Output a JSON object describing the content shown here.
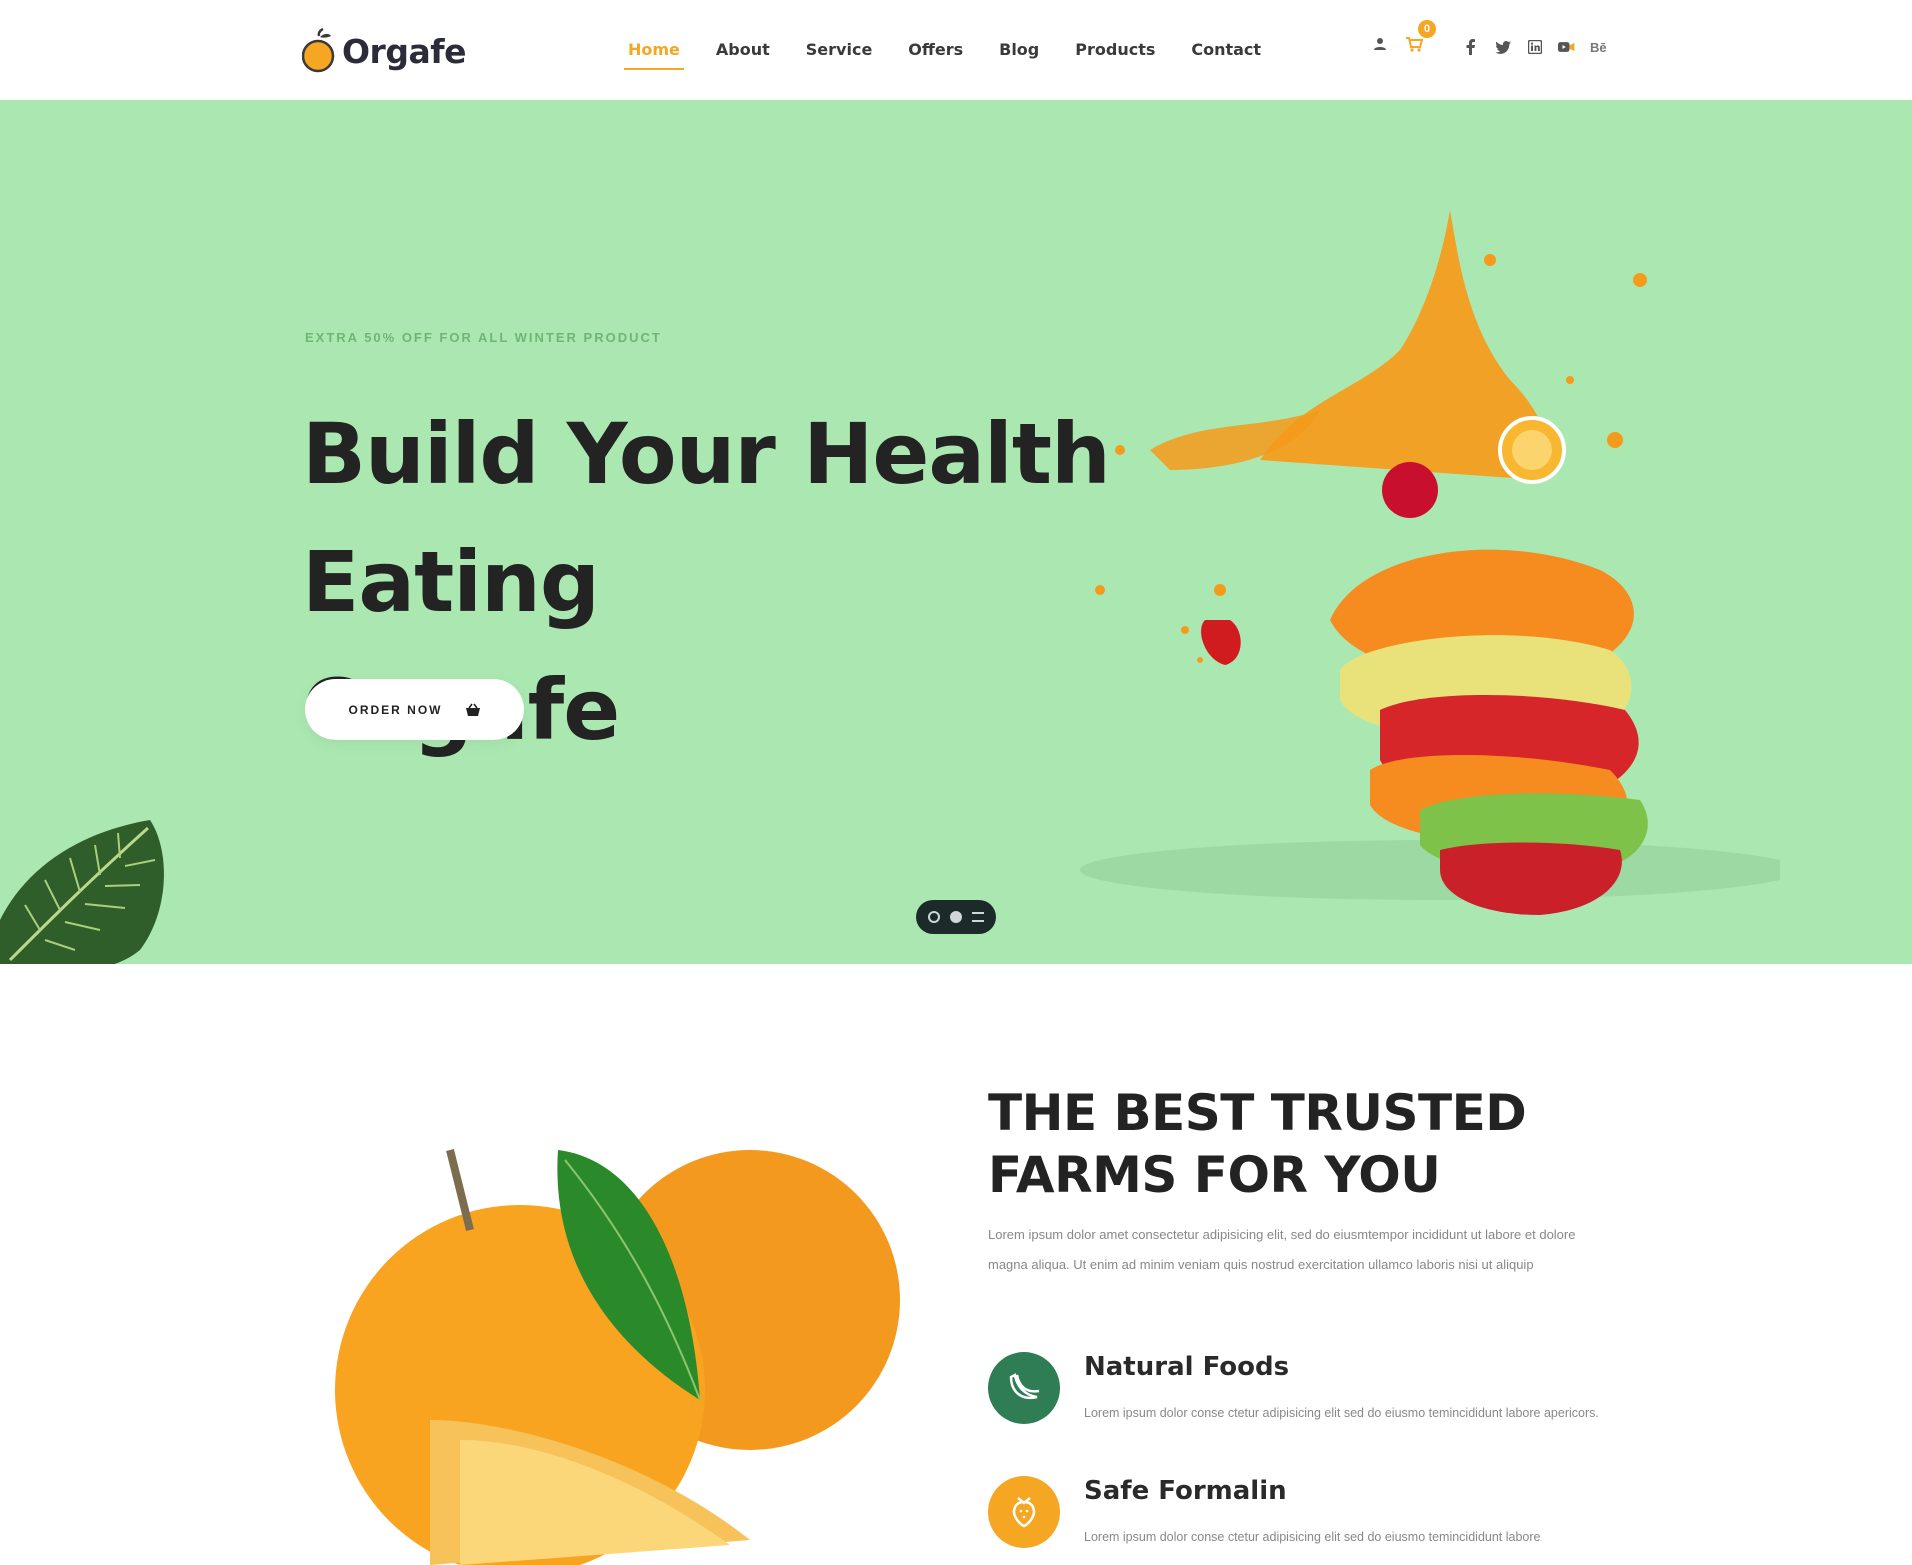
{
  "brand": {
    "name": "Orgafe",
    "accent": "#f5a623",
    "green": "#2e7d55",
    "hero_bg": "#abe8b1"
  },
  "nav": {
    "items": [
      {
        "label": "Home",
        "active": true
      },
      {
        "label": "About"
      },
      {
        "label": "Service"
      },
      {
        "label": "Offers"
      },
      {
        "label": "Blog"
      },
      {
        "label": "Products"
      },
      {
        "label": "Contact"
      }
    ]
  },
  "header": {
    "cart_count": "0",
    "icons": [
      "user-icon",
      "cart-icon"
    ],
    "social": [
      "facebook-icon",
      "twitter-icon",
      "linkedin-icon",
      "youtube-icon",
      "behance-icon"
    ],
    "behance_label": "Bē"
  },
  "hero": {
    "tag": "EXTRA 50% OFF FOR ALL WINTER PRODUCT",
    "title_line1": "Build Your Health Eating",
    "title_line2": "Orgafe",
    "button_label": "ORDER NOW"
  },
  "about": {
    "title_line1": "THE BEST TRUSTED",
    "title_line2": "FARMS FOR YOU",
    "description": "Lorem ipsum dolor amet consectetur adipisicing elit, sed do eiusmtempor incididunt ut labore et dolore magna aliqua. Ut enim ad minim veniam quis nostrud exercitation ullamco laboris nisi ut aliquip",
    "features": [
      {
        "title": "Natural Foods",
        "desc": "Lorem ipsum dolor conse ctetur adipisicing elit sed do eiusmo temincididunt labore apericors.",
        "icon": "banana-icon",
        "color": "#2e7d55"
      },
      {
        "title": "Safe Formalin",
        "desc": "Lorem ipsum dolor conse ctetur adipisicing elit sed do eiusmo temincididunt labore",
        "icon": "strawberry-icon",
        "color": "#f5a623"
      }
    ]
  }
}
